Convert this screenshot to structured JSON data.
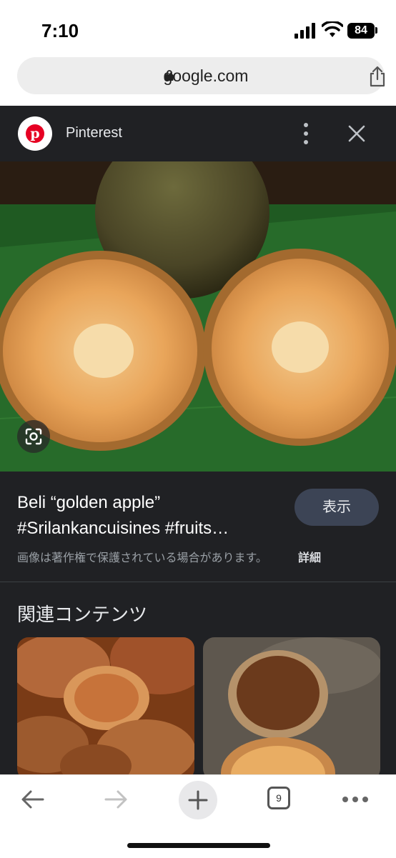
{
  "status": {
    "time": "7:10",
    "battery": "84"
  },
  "browser": {
    "url": "google.com",
    "tab_count": "9"
  },
  "result": {
    "source": "Pinterest",
    "title": "Beli “golden apple” #Srilankancuisines #fruits…",
    "view_button": "表示",
    "copyright_notice": "画像は著作権で保護されている場合があります。",
    "details_link": "詳細"
  },
  "related": {
    "heading": "関連コンテンツ"
  },
  "colors": {
    "pinterest_red": "#e60023",
    "panel_bg": "#202124",
    "button_bg": "#3c4455"
  }
}
